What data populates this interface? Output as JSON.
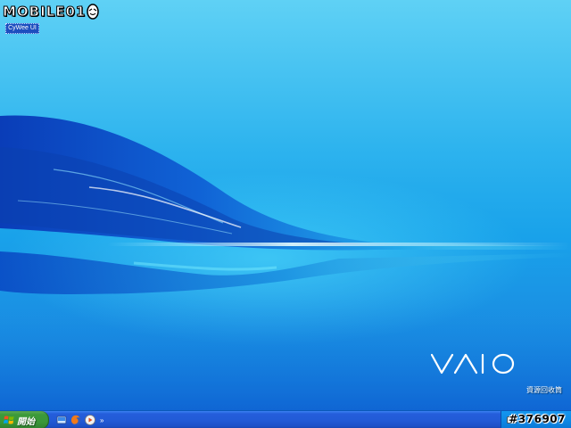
{
  "watermark": {
    "text": "MOBILE01",
    "icon": "mobile01-smiley-icon"
  },
  "desktop": {
    "icon_label": "CyWee UI",
    "brand_logo": "VAIO",
    "recycle_bin_label": "資源回收筒",
    "recycle_bin_icon": "recycle-bin-icon"
  },
  "taskbar": {
    "start_label": "開始",
    "start_icon": "windows-flag-icon",
    "quick_launch": [
      {
        "name": "show-desktop-icon"
      },
      {
        "name": "firefox-icon"
      },
      {
        "name": "media-player-icon"
      }
    ],
    "quick_launch_more": "»",
    "tray_icon": "keyboard-icon",
    "clock": ""
  },
  "post_id": "#376907",
  "colors": {
    "taskbar": "#245edb",
    "start_button": "#3c9a3a",
    "tray": "#0f8ae6",
    "desktop_top": "#5fd1f5",
    "desktop_bottom": "#1272d8"
  }
}
